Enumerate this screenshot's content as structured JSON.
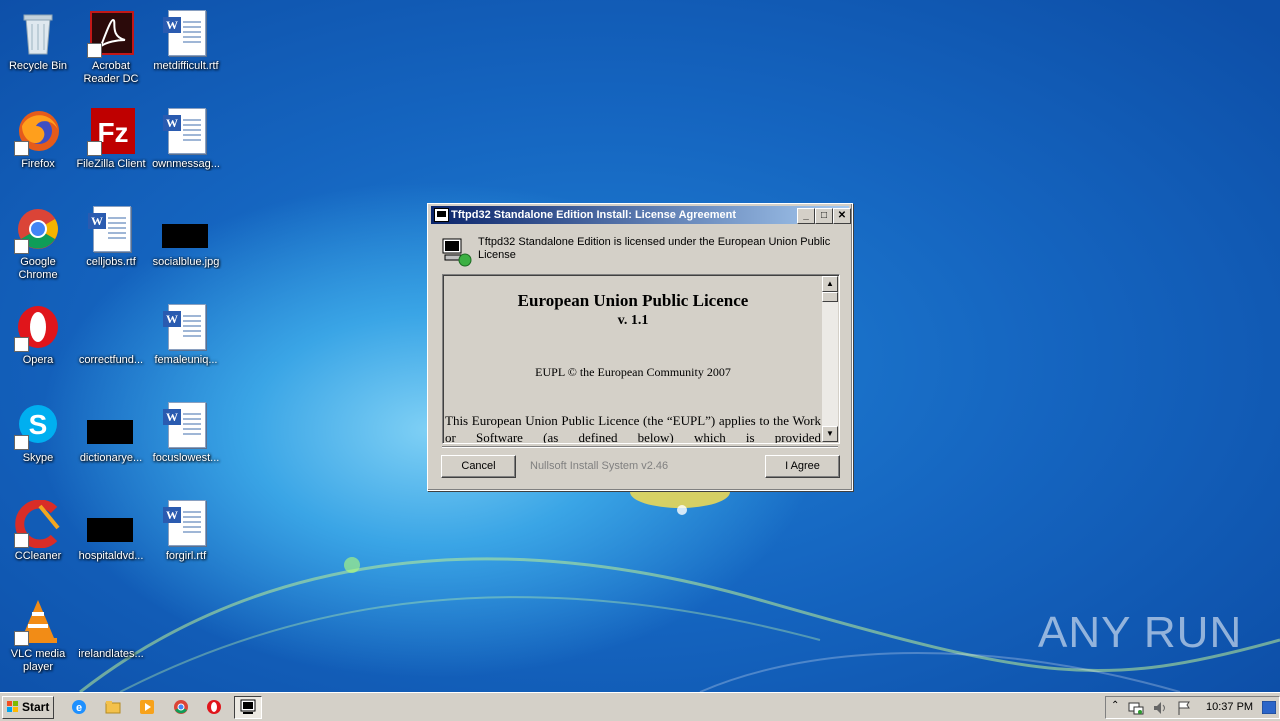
{
  "desktop": {
    "icons": [
      {
        "label": "Recycle Bin",
        "type": "recycle"
      },
      {
        "label": "Acrobat Reader DC",
        "type": "acrobat"
      },
      {
        "label": "metdifficult.rtf",
        "type": "word"
      },
      {
        "label": "Firefox",
        "type": "firefox"
      },
      {
        "label": "FileZilla Client",
        "type": "filezilla"
      },
      {
        "label": "ownmessag...",
        "type": "word"
      },
      {
        "label": "Google Chrome",
        "type": "chrome"
      },
      {
        "label": "celljobs.rtf",
        "type": "word"
      },
      {
        "label": "socialblue.jpg",
        "type": "black"
      },
      {
        "label": "Opera",
        "type": "opera"
      },
      {
        "label": "correctfund...",
        "type": "blank"
      },
      {
        "label": "femaleuniq...",
        "type": "word"
      },
      {
        "label": "Skype",
        "type": "skype"
      },
      {
        "label": "dictionarye...",
        "type": "black"
      },
      {
        "label": "focuslowest...",
        "type": "word"
      },
      {
        "label": "CCleaner",
        "type": "ccleaner"
      },
      {
        "label": "hospitaldvd...",
        "type": "black"
      },
      {
        "label": "forgirl.rtf",
        "type": "word"
      },
      {
        "label": "VLC media player",
        "type": "vlc"
      },
      {
        "label": "irelandlates...",
        "type": "blank"
      }
    ],
    "watermark": "ANY RUN"
  },
  "dialog": {
    "title": "Tftpd32 Standalone Edition Install: License Agreement",
    "header_text": "Tftpd32 Standalone Edition is licensed under the European Union Public License",
    "license": {
      "title": "European Union Public Licence",
      "version": "v. 1.1",
      "copyright": "EUPL © the European Community 2007",
      "paragraph": "This European Union Public Licence (the “EUPL”) applies to the Work or Software (as defined below) which is provided"
    },
    "cancel_label": "Cancel",
    "brand_text": "Nullsoft Install System v2.46",
    "agree_label": "I Agree"
  },
  "taskbar": {
    "start_label": "Start",
    "clock": "10:37 PM"
  },
  "colors": {
    "title_active": "#0a246a",
    "dialog_face": "#d4d0c8"
  }
}
